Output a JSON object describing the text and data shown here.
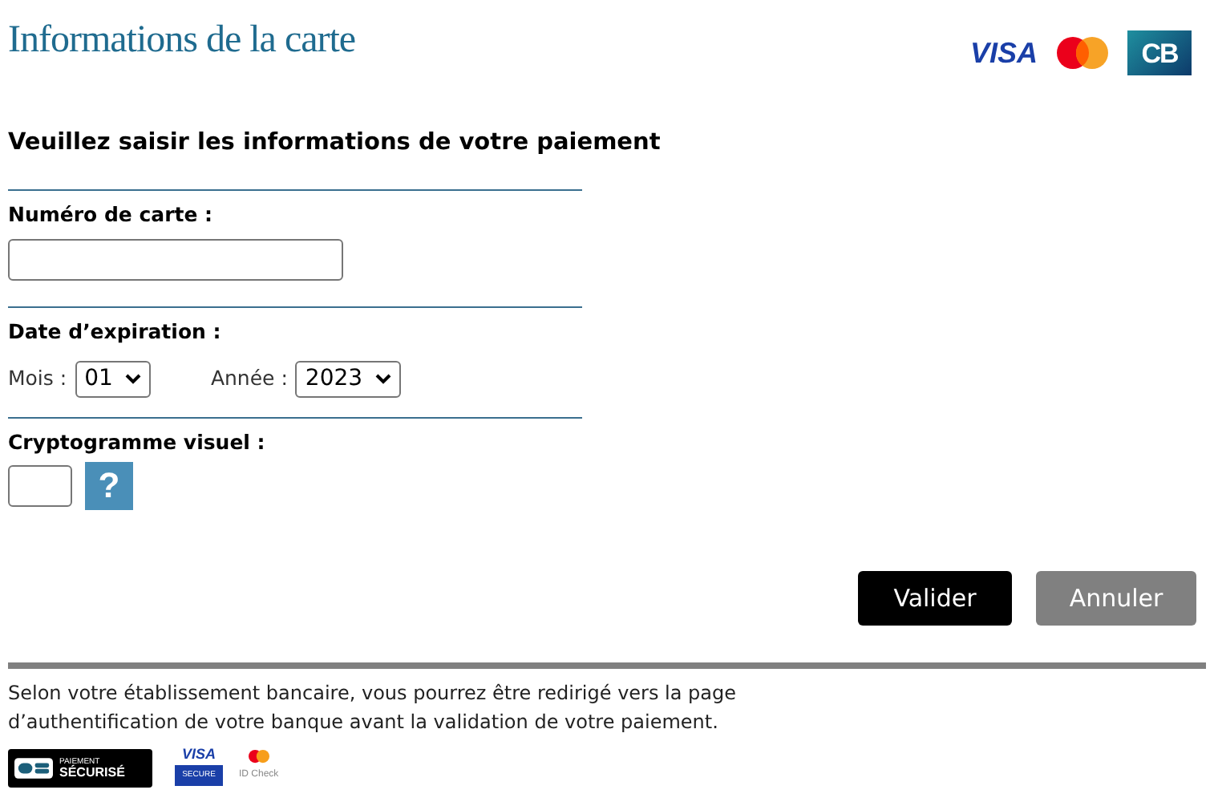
{
  "title": "Informations de la carte",
  "brand_logos": {
    "visa": "VISA",
    "cb": "CB"
  },
  "heading": "Veuillez saisir les informations de votre paiement",
  "card_number": {
    "label": "Numéro de carte :"
  },
  "expiry": {
    "label": "Date d’expiration :",
    "month": {
      "label": "Mois :",
      "value": "01"
    },
    "year": {
      "label": "Année :",
      "value": "2023"
    }
  },
  "cvv": {
    "label": "Cryptogramme visuel :",
    "help": "?"
  },
  "buttons": [
    {
      "label": "Valider",
      "kind": "primary"
    },
    {
      "label": "Annuler",
      "kind": "secondary"
    }
  ],
  "notice": "Selon votre établissement bancaire, vous pourrez être redirigé vers la page d’authentification de votre banque avant la validation de votre paiement.",
  "footer_badges": {
    "secure_top": "PAIEMENT",
    "secure_bottom": "SÉCURISÉ",
    "visa": "VISA",
    "visa_secure": "SECURE",
    "idcheck": "ID Check"
  }
}
